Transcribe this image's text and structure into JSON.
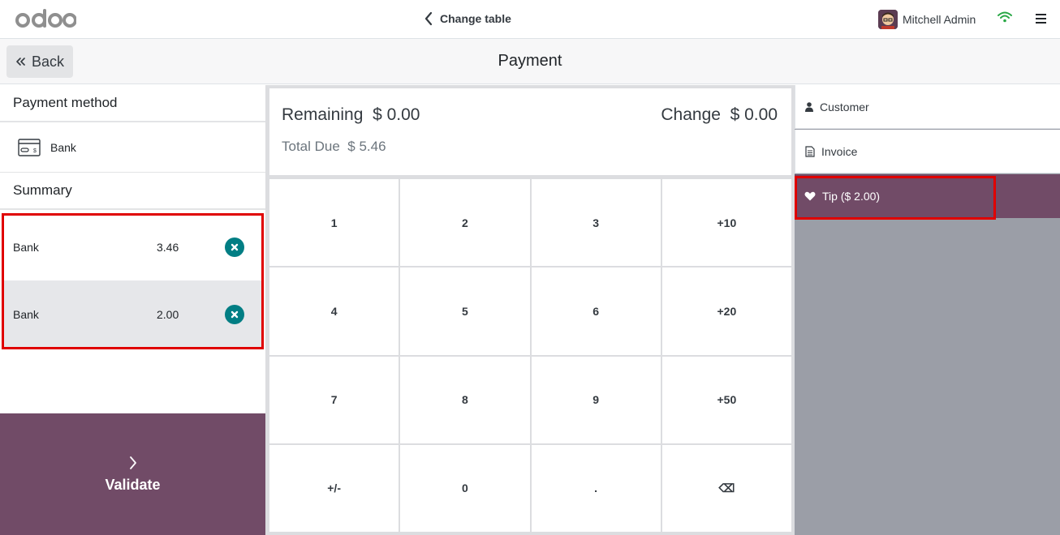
{
  "topbar": {
    "logo_text": "odoo",
    "change_table_label": "Change table",
    "user_name": "Mitchell Admin"
  },
  "subbar": {
    "back_label": "Back",
    "title": "Payment"
  },
  "left": {
    "payment_method_title": "Payment method",
    "payment_methods": [
      {
        "label": "Bank",
        "icon": "bank-card-icon"
      }
    ],
    "summary_title": "Summary",
    "lines": [
      {
        "name": "Bank",
        "amount": "3.46"
      },
      {
        "name": "Bank",
        "amount": "2.00"
      }
    ],
    "validate_label": "Validate"
  },
  "totals": {
    "remaining_label": "Remaining",
    "remaining_value": "$ 0.00",
    "change_label": "Change",
    "change_value": "$ 0.00",
    "total_due_label": "Total Due",
    "total_due_value": "$ 5.46"
  },
  "numpad": {
    "keys": [
      "1",
      "2",
      "3",
      "+10",
      "4",
      "5",
      "6",
      "+20",
      "7",
      "8",
      "9",
      "+50",
      "+/-",
      "0",
      ".",
      "⌫"
    ]
  },
  "right": {
    "customer_label": "Customer",
    "invoice_label": "Invoice",
    "tip_label": "Tip ($ 2.00)"
  },
  "colors": {
    "brand": "#714B67",
    "delete": "#017e84",
    "highlight": "#e00000",
    "wifi": "#28a745"
  }
}
